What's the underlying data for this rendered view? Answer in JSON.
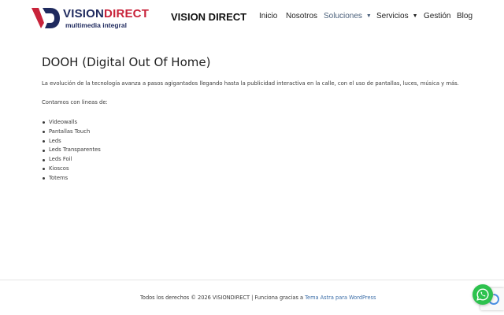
{
  "header": {
    "logo": {
      "word_part1": "VISION",
      "word_part2": "DIRECT",
      "tagline": "multimedia integral",
      "mark_letters": "VD"
    },
    "site_title": "VISION DIRECT",
    "nav": [
      {
        "label": "Inicio",
        "active": false,
        "has_submenu": false
      },
      {
        "label": "Nosotros",
        "active": false,
        "has_submenu": false
      },
      {
        "label": "Soluciones",
        "active": true,
        "has_submenu": true
      },
      {
        "label": "Servicios",
        "active": false,
        "has_submenu": true
      },
      {
        "label": "Gestión",
        "active": false,
        "has_submenu": false
      },
      {
        "label": "Blog",
        "active": false,
        "has_submenu": false
      }
    ]
  },
  "main": {
    "title": "DOOH (Digital Out Of Home)",
    "intro": "La evolución de la tecnología avanza a pasos agigantados llegando hasta la publicidad interactiva en la calle, con el uso de pantallas, luces, música y más.",
    "lines_label": "Contamos con lineas de:",
    "lines": [
      "Videowalls",
      "Pantallas Touch",
      "Leds",
      "Leds Transparentes",
      "Leds Foil",
      "Kioscos",
      "Totems"
    ]
  },
  "footer": {
    "copyright": "Todos los derechos © 2026 VISIONDIRECT | Funciona gracias a ",
    "theme_link": "Tema Astra para WordPress"
  },
  "widgets": {
    "whatsapp_icon": "whatsapp-icon",
    "recaptcha_icon": "recaptcha-icon"
  },
  "colors": {
    "logo_navy": "#1f2a5e",
    "logo_red": "#c8233a",
    "nav_active": "#4a5f7a",
    "link": "#3c6ea8",
    "whatsapp_green": "#2dc24e"
  }
}
